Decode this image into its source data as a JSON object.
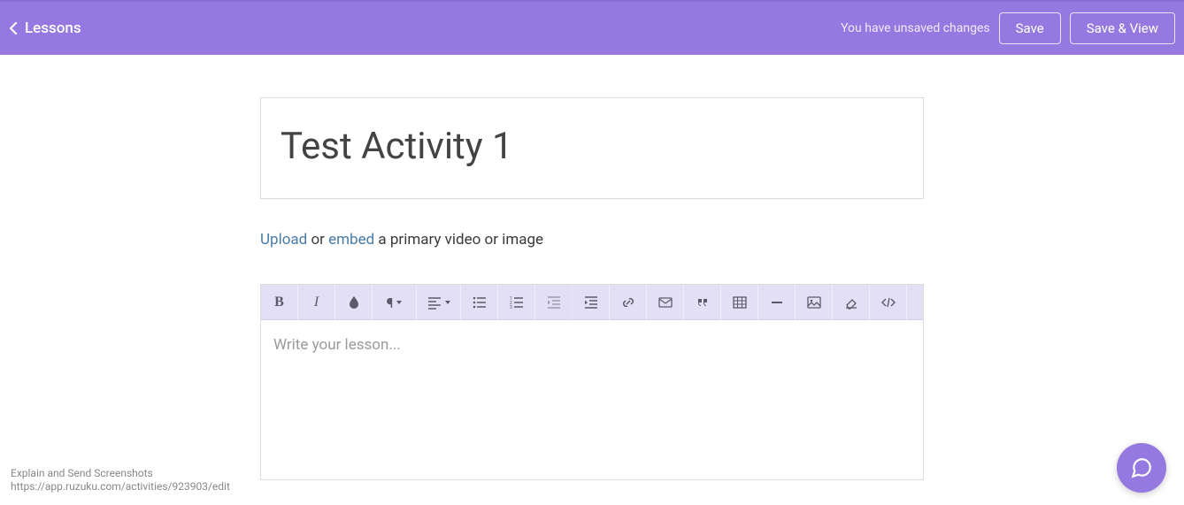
{
  "header": {
    "back_label": "Lessons",
    "unsaved_label": "You have unsaved changes",
    "save_label": "Save",
    "save_view_label": "Save & View"
  },
  "title": {
    "value": "Test Activity 1"
  },
  "media_line": {
    "upload": "Upload",
    "or": " or ",
    "embed": "embed",
    "rest": " a primary video or image"
  },
  "editor": {
    "placeholder": "Write your lesson..."
  },
  "watermark": {
    "line1": "Explain and Send Screenshots",
    "line2": "https://app.ruzuku.com/activities/923903/edit"
  },
  "toolbar_icons": [
    "bold",
    "italic",
    "color",
    "paragraph",
    "align",
    "unordered-list",
    "ordered-list",
    "outdent",
    "indent",
    "link",
    "email",
    "quote",
    "table",
    "hr",
    "image",
    "clear-format",
    "code"
  ]
}
